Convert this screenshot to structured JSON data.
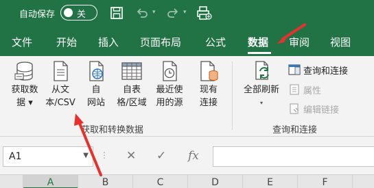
{
  "titlebar": {
    "autosave_label": "自动保存",
    "toggle_state": "关",
    "icons": [
      "save-icon",
      "undo-icon",
      "redo-icon",
      "customize-quick-access-icon"
    ],
    "background": "#217346"
  },
  "tabs": [
    {
      "label": "文件"
    },
    {
      "label": "开始"
    },
    {
      "label": "插入"
    },
    {
      "label": "页面布局"
    },
    {
      "label": "公式"
    },
    {
      "label": "数据",
      "active": true
    },
    {
      "label": "审阅"
    },
    {
      "label": "视图"
    }
  ],
  "ribbon": {
    "get_transform": {
      "group_label": "获取和转换数据",
      "buttons": [
        {
          "line1": "获取数",
          "line2": "据 ▾"
        },
        {
          "line1": "从文",
          "line2": "本/CSV"
        },
        {
          "line1": "自",
          "line2": "网站"
        },
        {
          "line1": "自表",
          "line2": "格/区域"
        },
        {
          "line1": "最近使",
          "line2": "用的源"
        },
        {
          "line1": "现有",
          "line2": "连接"
        }
      ]
    },
    "queries_connections": {
      "group_label": "查询和连接",
      "refresh_all": {
        "line1": "全部刷新",
        "line2": "▾"
      },
      "items": [
        {
          "label": "查询和连接",
          "enabled": true
        },
        {
          "label": "属性",
          "enabled": false
        },
        {
          "label": "编辑链接",
          "enabled": false
        }
      ]
    }
  },
  "formula_bar": {
    "name_box": "A1",
    "cancel_symbol": "✕",
    "enter_symbol": "✓",
    "fx_symbol": "fx",
    "formula_value": ""
  },
  "columns": [
    "A",
    "B",
    "C",
    "D",
    "E",
    "F"
  ],
  "selected_column": "A",
  "annotation_color": "#e8312a"
}
